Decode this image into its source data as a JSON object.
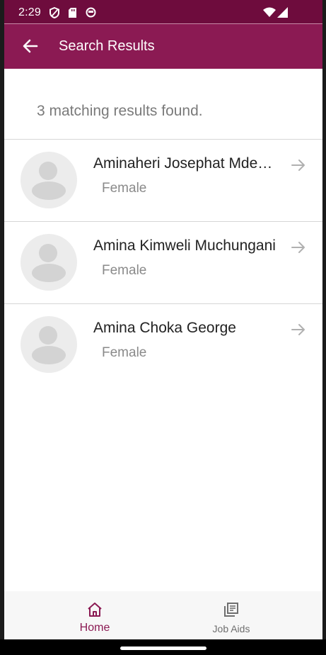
{
  "status_bar": {
    "time": "2:29",
    "icons": [
      "shield-icon",
      "sd-card-icon",
      "face-icon",
      "wifi-icon",
      "signal-icon"
    ]
  },
  "app_bar": {
    "title": "Search Results",
    "back_icon": "arrow-back-icon",
    "background": "#8b1a53"
  },
  "results": {
    "count_text": "3 matching results found.",
    "items": [
      {
        "name": "Aminaheri Josephat Mdemu",
        "gender": "Female"
      },
      {
        "name": "Amina Kimweli Muchungani",
        "gender": "Female"
      },
      {
        "name": "Amina Choka George",
        "gender": "Female"
      }
    ]
  },
  "bottom_nav": {
    "items": [
      {
        "label": "Home",
        "icon": "home-icon",
        "active": true,
        "color": "#8b1a53"
      },
      {
        "label": "Job Aids",
        "icon": "library-books-icon",
        "active": false,
        "color": "#6f6f6f"
      }
    ]
  }
}
